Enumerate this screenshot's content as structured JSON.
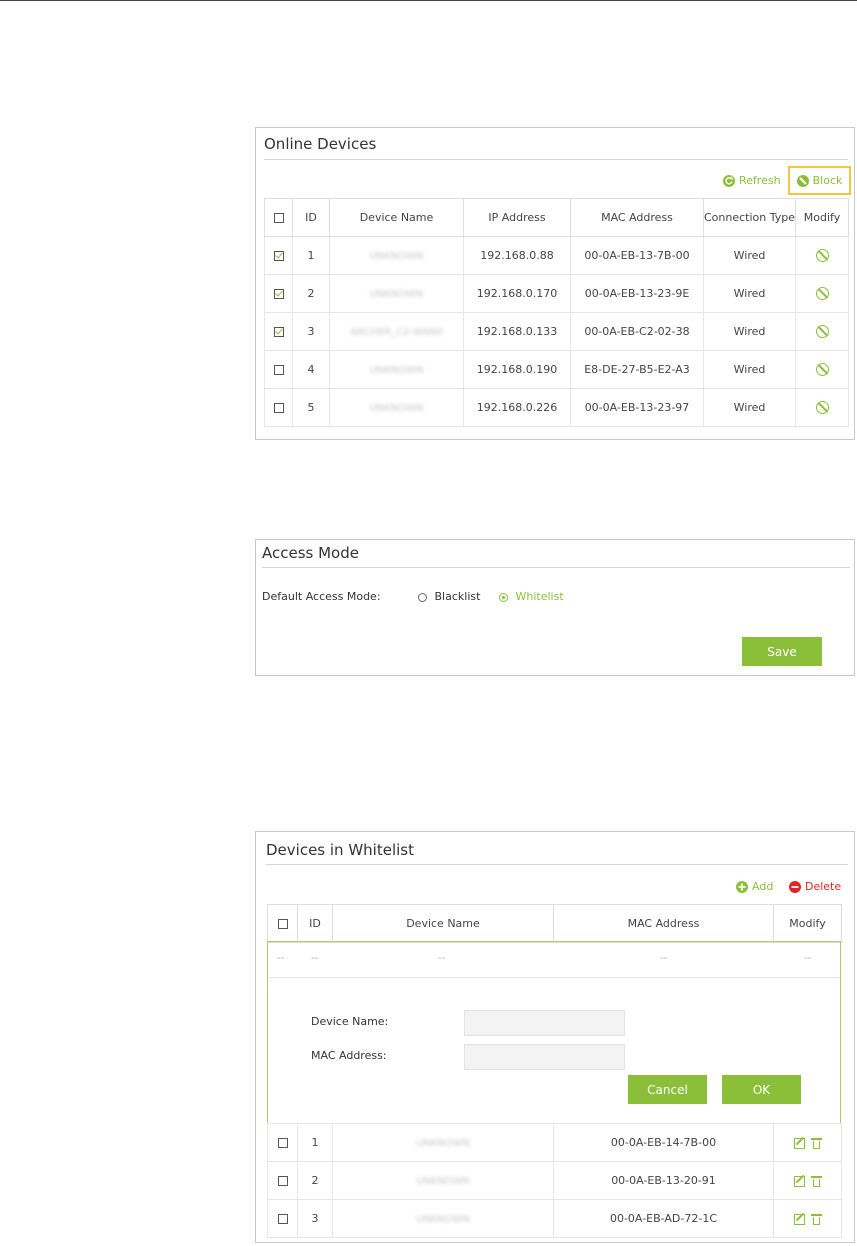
{
  "colors": {
    "accent": "#8bbf3a",
    "delete": "#e02424",
    "highlight": "#f5c542"
  },
  "online": {
    "title": "Online Devices",
    "refresh_label": "Refresh",
    "block_label": "Block",
    "columns": [
      "ID",
      "Device Name",
      "IP Address",
      "MAC Address",
      "Connection Type",
      "Modify"
    ],
    "rows": [
      {
        "id": "1",
        "name": "UNKNOWN",
        "ip": "192.168.0.88",
        "mac": "00-0A-EB-13-7B-00",
        "type": "Wired",
        "checked": true
      },
      {
        "id": "2",
        "name": "UNKNOWN",
        "ip": "192.168.0.170",
        "mac": "00-0A-EB-13-23-9E",
        "type": "Wired",
        "checked": true
      },
      {
        "id": "3",
        "name": "ARCHER_C2-WAN0",
        "ip": "192.168.0.133",
        "mac": "00-0A-EB-C2-02-38",
        "type": "Wired",
        "checked": true
      },
      {
        "id": "4",
        "name": "UNKNOWN",
        "ip": "192.168.0.190",
        "mac": "E8-DE-27-B5-E2-A3",
        "type": "Wired",
        "checked": false
      },
      {
        "id": "5",
        "name": "UNKNOWN",
        "ip": "192.168.0.226",
        "mac": "00-0A-EB-13-23-97",
        "type": "Wired",
        "checked": false
      }
    ]
  },
  "access": {
    "title": "Access Mode",
    "default_label": "Default Access Mode:",
    "blacklist_label": "Blacklist",
    "whitelist_label": "Whitelist",
    "selected": "Whitelist",
    "save_label": "Save"
  },
  "whitelist": {
    "title": "Devices in Whitelist",
    "add_label": "Add",
    "delete_label": "Delete",
    "columns": [
      "ID",
      "Device Name",
      "MAC Address",
      "Modify"
    ],
    "placeholder_row": [
      "--",
      "--",
      "--",
      "--",
      "--"
    ],
    "form": {
      "device_name_label": "Device Name:",
      "mac_label": "MAC Address:",
      "device_name_value": "",
      "mac_value": "",
      "cancel_label": "Cancel",
      "ok_label": "OK"
    },
    "rows": [
      {
        "id": "1",
        "name": "UNKNOWN",
        "mac": "00-0A-EB-14-7B-00"
      },
      {
        "id": "2",
        "name": "UNKNOWN",
        "mac": "00-0A-EB-13-20-91"
      },
      {
        "id": "3",
        "name": "UNKNOWN",
        "mac": "00-0A-EB-AD-72-1C"
      }
    ]
  }
}
